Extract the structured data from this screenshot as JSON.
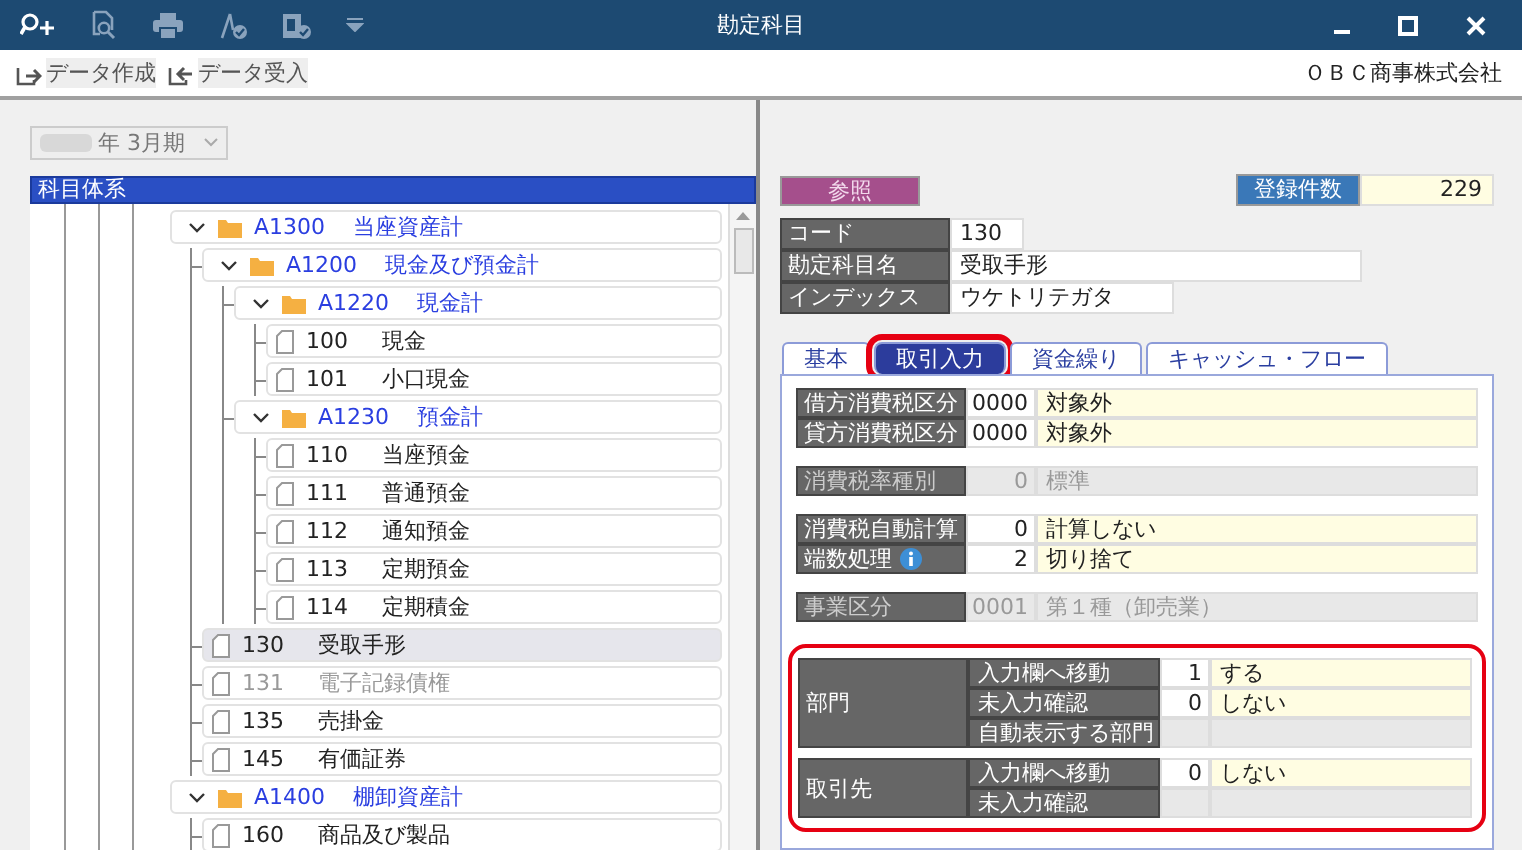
{
  "window": {
    "title": "勘定科目"
  },
  "toolbar": {
    "actions": [
      {
        "label": "データ作成",
        "kind": "export"
      },
      {
        "label": "データ受入",
        "kind": "import"
      }
    ],
    "company": "ＯＢＣ商事株式会社"
  },
  "period": {
    "value": "年 3月期"
  },
  "tree": {
    "header": "科目体系",
    "items": [
      {
        "kind": "folder",
        "code": "A1300",
        "name": "当座資産計",
        "expanded": true,
        "selected": false,
        "disabled": false,
        "children": [
          {
            "kind": "folder",
            "code": "A1200",
            "name": "現金及び預金計",
            "expanded": true,
            "selected": false,
            "disabled": false,
            "children": [
              {
                "kind": "folder",
                "code": "A1220",
                "name": "現金計",
                "expanded": true,
                "selected": false,
                "disabled": false,
                "children": [
                  {
                    "kind": "account",
                    "code": "100",
                    "name": "現金",
                    "selected": false,
                    "disabled": false
                  },
                  {
                    "kind": "account",
                    "code": "101",
                    "name": "小口現金",
                    "selected": false,
                    "disabled": false
                  }
                ]
              },
              {
                "kind": "folder",
                "code": "A1230",
                "name": "預金計",
                "expanded": true,
                "selected": false,
                "disabled": false,
                "children": [
                  {
                    "kind": "account",
                    "code": "110",
                    "name": "当座預金",
                    "selected": false,
                    "disabled": false
                  },
                  {
                    "kind": "account",
                    "code": "111",
                    "name": "普通預金",
                    "selected": false,
                    "disabled": false
                  },
                  {
                    "kind": "account",
                    "code": "112",
                    "name": "通知預金",
                    "selected": false,
                    "disabled": false
                  },
                  {
                    "kind": "account",
                    "code": "113",
                    "name": "定期預金",
                    "selected": false,
                    "disabled": false
                  },
                  {
                    "kind": "account",
                    "code": "114",
                    "name": "定期積金",
                    "selected": false,
                    "disabled": false
                  }
                ]
              }
            ]
          },
          {
            "kind": "account",
            "code": "130",
            "name": "受取手形",
            "selected": true,
            "disabled": false
          },
          {
            "kind": "account",
            "code": "131",
            "name": "電子記録債権",
            "selected": false,
            "disabled": true
          },
          {
            "kind": "account",
            "code": "135",
            "name": "売掛金",
            "selected": false,
            "disabled": false
          },
          {
            "kind": "account",
            "code": "145",
            "name": "有価証券",
            "selected": false,
            "disabled": false
          }
        ]
      },
      {
        "kind": "folder",
        "code": "A1400",
        "name": "棚卸資産計",
        "expanded": true,
        "selected": false,
        "disabled": false,
        "children": [
          {
            "kind": "account",
            "code": "160",
            "name": "商品及び製品",
            "selected": false,
            "disabled": false
          }
        ]
      }
    ]
  },
  "detail": {
    "mode": "参照",
    "count": {
      "label": "登録件数",
      "value": "229"
    },
    "fields": [
      {
        "label": "コード",
        "value": "130"
      },
      {
        "label": "勘定科目名",
        "value": "受取手形"
      },
      {
        "label": "インデックス",
        "value": "ウケトリテガタ"
      }
    ],
    "tabs": [
      {
        "label": "基本",
        "selected": false,
        "highlighted": false
      },
      {
        "label": "取引入力",
        "selected": true,
        "highlighted": true
      },
      {
        "label": "資金繰り",
        "selected": false,
        "highlighted": false
      },
      {
        "label": "キャッシュ・フロー",
        "selected": false,
        "highlighted": false
      }
    ],
    "settings": [
      {
        "rows": [
          {
            "label": "借方消費税区分",
            "code": "0000",
            "value": "対象外",
            "disabled": false,
            "info": false
          },
          {
            "label": "貸方消費税区分",
            "code": "0000",
            "value": "対象外",
            "disabled": false,
            "info": false
          }
        ]
      },
      {
        "rows": [
          {
            "label": "消費税率種別",
            "code": "0",
            "value": "標準",
            "disabled": true,
            "info": false
          }
        ]
      },
      {
        "rows": [
          {
            "label": "消費税自動計算",
            "code": "0",
            "value": "計算しない",
            "disabled": false,
            "info": false
          },
          {
            "label": "端数処理",
            "code": "2",
            "value": "切り捨て",
            "disabled": false,
            "info": true
          }
        ]
      },
      {
        "rows": [
          {
            "label": "事業区分",
            "code": "0001",
            "value": "第１種（卸売業）",
            "disabled": true,
            "info": false
          }
        ]
      }
    ],
    "sections": {
      "highlighted": true,
      "groups": [
        {
          "label": "部門",
          "rows": [
            {
              "label": "入力欄へ移動",
              "code": "1",
              "value": "する"
            },
            {
              "label": "未入力確認",
              "code": "0",
              "value": "しない"
            },
            {
              "label": "自動表示する部門"
            }
          ]
        },
        {
          "label": "取引先",
          "rows": [
            {
              "label": "入力欄へ移動",
              "code": "0",
              "value": "しない"
            },
            {
              "label": "未入力確認"
            }
          ]
        }
      ]
    }
  }
}
